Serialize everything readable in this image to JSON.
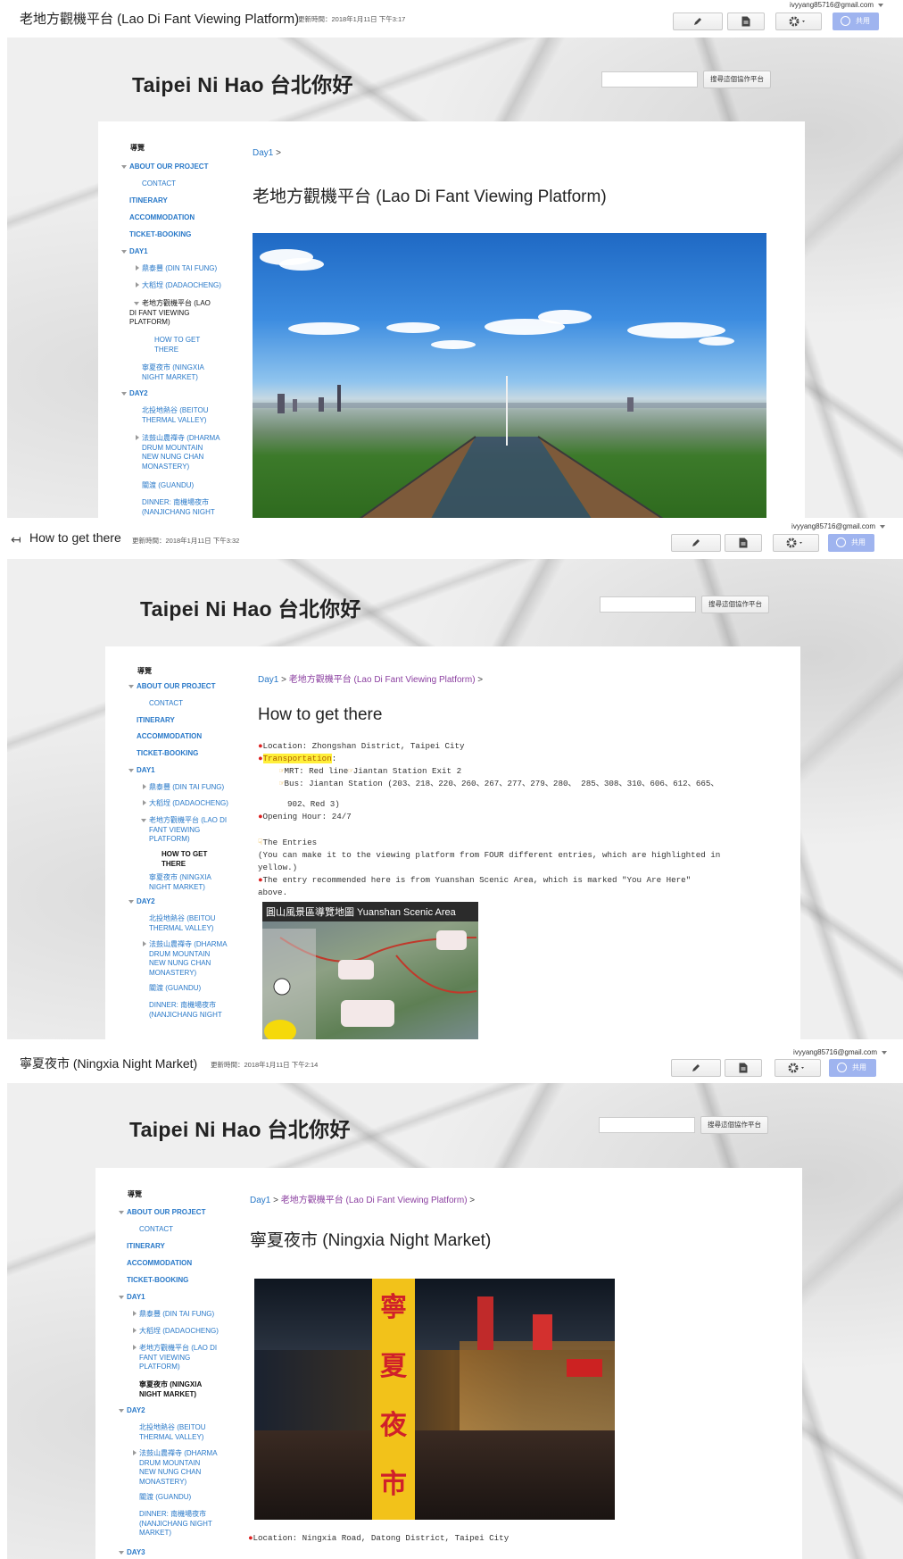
{
  "account": "ivyyang85716@gmail.com",
  "toolbar": {
    "share_label": "共用"
  },
  "site": {
    "name": "Taipei Ni Hao 台北你好",
    "search_button": "搜尋這個協作平台"
  },
  "sidebar": {
    "heading": "導覽",
    "about": "ABOUT OUR PROJECT",
    "contact": "CONTACT",
    "itinerary": "ITINERARY",
    "accommodation": "ACCOMMODATION",
    "ticket": "TICKET-BOOKING",
    "day1": "DAY1",
    "din_tai_fung": "鼎泰豐 (DIN TAI FUNG)",
    "dadaocheng": "大稻埕 (DADAOCHENG)",
    "lao_di_l1": "老地方觀機平台 (LAO",
    "lao_di_l2": "DI FANT VIEWING",
    "lao_di_l3": "PLATFORM)",
    "lao_di_alt_l1": "老地方觀機平台 (LAO DI",
    "lao_di_alt_l2": "FANT VIEWING",
    "lao_di_alt_l3": "PLATFORM)",
    "how_l1": "HOW TO GET",
    "how_l2": "THERE",
    "ningxia_l1": "寧夏夜市 (NINGXIA",
    "ningxia_l2": "NIGHT MARKET)",
    "day2": "DAY2",
    "beitou_l1": "北投地熱谷 (BEITOU",
    "beitou_l2": "THERMAL VALLEY)",
    "dharma_l1": "法鼓山農禪寺 (DHARMA",
    "dharma_l2": "DRUM MOUNTAIN",
    "dharma_l3": "NEW NUNG CHAN",
    "dharma_l4": "MONASTERY)",
    "guandu": "關渡 (GUANDU)",
    "dinner_l1": "DINNER: 南機場夜市",
    "dinner_l2": "(NANJICHANG NIGHT",
    "dinner_l3": "MARKET)",
    "day3": "DAY3"
  },
  "panel1": {
    "title": "老地方觀機平台 (Lao Di Fant Viewing Platform)",
    "updated": "更新時間：2018年1月11日 下午3:17",
    "crumb_day1": "Day1",
    "heading": "老地方觀機平台 (Lao Di Fant Viewing Platform)"
  },
  "panel2": {
    "title": "How to get there",
    "updated": "更新時間：2018年1月11日 下午3:32",
    "crumb_day1": "Day1",
    "crumb_page": "老地方觀機平台 (Lao Di Fant Viewing Platform)",
    "heading": "How to get there",
    "location": "Location: Zhongshan District, Taipei City",
    "transport_label": "Transportation",
    "mrt": "MRT: Red line",
    "mrt_station": "Jiantan Station Exit 2",
    "bus": "Bus: Jiantan Station (203、218、220、260、267、277、279、280、 285、308、310、606、612、665、",
    "bus2": "902、Red 3)",
    "hours": "Opening Hour: 24/7",
    "entries": "The Entries",
    "entries_desc1": "(You can make it to the viewing platform from FOUR different entries, which are highlighted in",
    "entries_desc2": "yellow.)",
    "recommend1": "The entry recommended here is from Yuanshan Scenic Area, which is marked \"You Are Here\"",
    "recommend2": "above.",
    "map_title": "圓山風景區導覽地圖 Yuanshan Scenic Area"
  },
  "panel3": {
    "title": "寧夏夜市 (Ningxia Night Market)",
    "updated": "更新時間：2018年1月11日 下午2:14",
    "crumb_day1": "Day1",
    "crumb_page": "老地方觀機平台 (Lao Di Fant Viewing Platform)",
    "heading": "寧夏夜市 (Ningxia Night Market)",
    "location": "Location: Ningxia Road, Datong District, Taipei City",
    "sign_text": "寧夏夜市"
  }
}
